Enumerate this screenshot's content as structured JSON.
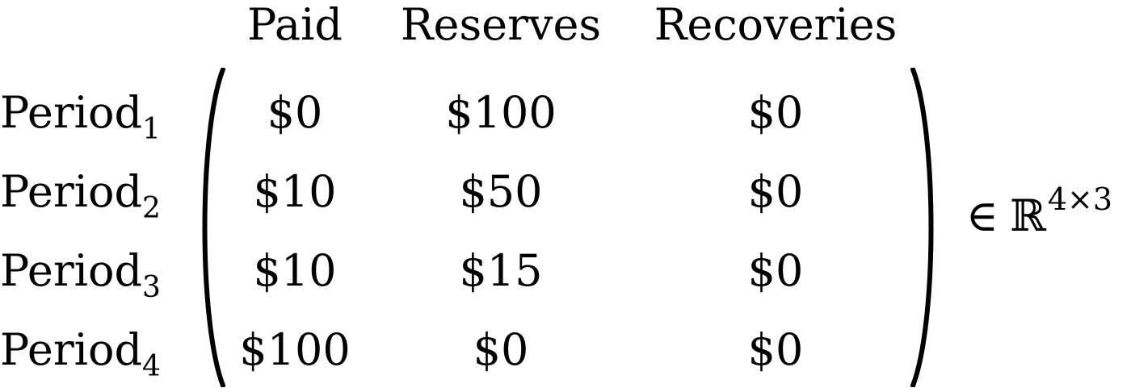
{
  "matrix": {
    "columns": [
      "Paid",
      "Reserves",
      "Recoveries"
    ],
    "rows": [
      {
        "label": "Period",
        "sub": "1",
        "values": [
          "$0",
          "$100",
          "$0"
        ]
      },
      {
        "label": "Period",
        "sub": "2",
        "values": [
          "$10",
          "$50",
          "$0"
        ]
      },
      {
        "label": "Period",
        "sub": "3",
        "values": [
          "$10",
          "$15",
          "$0"
        ]
      },
      {
        "label": "Period",
        "sub": "4",
        "values": [
          "$100",
          "$0",
          "$0"
        ]
      }
    ],
    "membership": {
      "symbol": "∈",
      "set": "ℝ",
      "dimension": "4×3"
    }
  }
}
